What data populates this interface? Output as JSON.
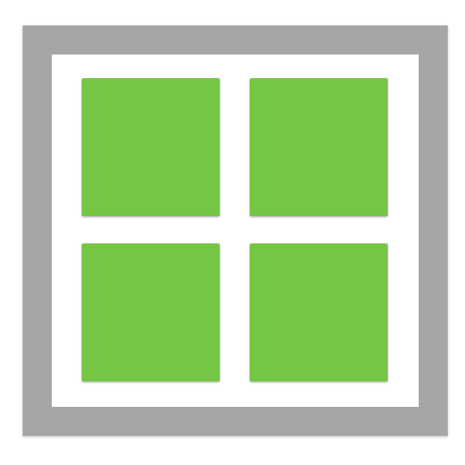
{
  "icon": {
    "name": "window-grid-icon",
    "frame_color": "#a6a6a6",
    "background_color": "#ffffff",
    "tile_color": "#76c646",
    "tiles": [
      {
        "name": "tile-top-left"
      },
      {
        "name": "tile-top-right"
      },
      {
        "name": "tile-bottom-left"
      },
      {
        "name": "tile-bottom-right"
      }
    ]
  }
}
